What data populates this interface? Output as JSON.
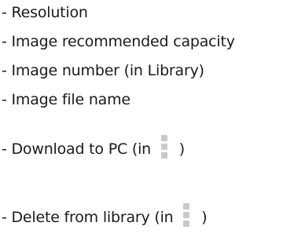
{
  "items": [
    {
      "text": "- Resolution"
    },
    {
      "text": "- Image recommended capacity"
    },
    {
      "text": "- Image number (in Library)"
    },
    {
      "text": "- Image file name"
    },
    {
      "prefix": "- Download to PC (in",
      "icon": "vertical-dots-icon",
      "suffix": ")"
    },
    {
      "prefix": "- Delete from library (in",
      "icon": "vertical-dots-icon",
      "suffix": ")"
    }
  ]
}
